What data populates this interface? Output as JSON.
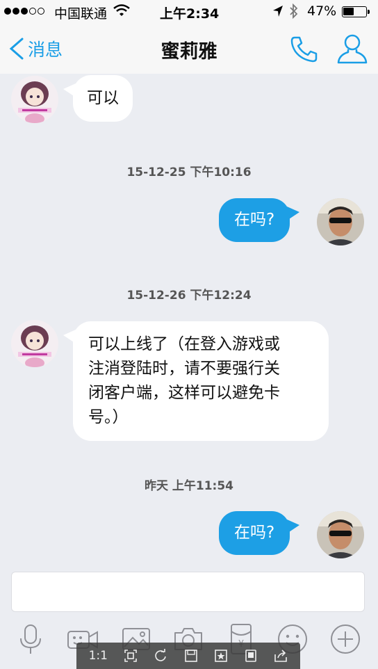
{
  "status_bar": {
    "carrier": "中国联通",
    "time": "上午2:34",
    "battery_percent": "47%",
    "battery_level": 0.47
  },
  "nav": {
    "back_label": "消息",
    "title": "蜜莉雅",
    "accent_color": "#1a9ee6"
  },
  "messages": [
    {
      "kind": "bubble",
      "side": "left",
      "text": "可以"
    },
    {
      "kind": "timestamp",
      "text": "15-12-25 下午10:16"
    },
    {
      "kind": "bubble",
      "side": "right",
      "text": "在吗?"
    },
    {
      "kind": "timestamp",
      "text": "15-12-26 下午12:24"
    },
    {
      "kind": "bubble",
      "side": "left",
      "lines": [
        "可以上线了（在登入游戏或",
        "注消登陆时，请不要强行关",
        "闭客户端，这样可以避免卡",
        "号。）"
      ]
    },
    {
      "kind": "timestamp",
      "text": "昨天 上午11:54"
    },
    {
      "kind": "bubble",
      "side": "right",
      "text": "在吗?"
    }
  ],
  "input": {
    "value": "",
    "placeholder": ""
  },
  "toolbar": {
    "icons": [
      "microphone-icon",
      "video-icon",
      "image-icon",
      "camera-icon",
      "red-packet-icon",
      "emoji-icon",
      "plus-icon"
    ],
    "red_packet_symbol": "¥"
  },
  "viewer_bar": {
    "zoom_label": "1:1",
    "icons": [
      "fit-icon",
      "rotate-icon",
      "save-icon",
      "favorite-icon",
      "tablet-icon",
      "share-icon"
    ]
  },
  "colors": {
    "outgoing_bubble": "#1d9fe5",
    "incoming_bubble": "#ffffff",
    "chat_background": "#ebedf2"
  }
}
